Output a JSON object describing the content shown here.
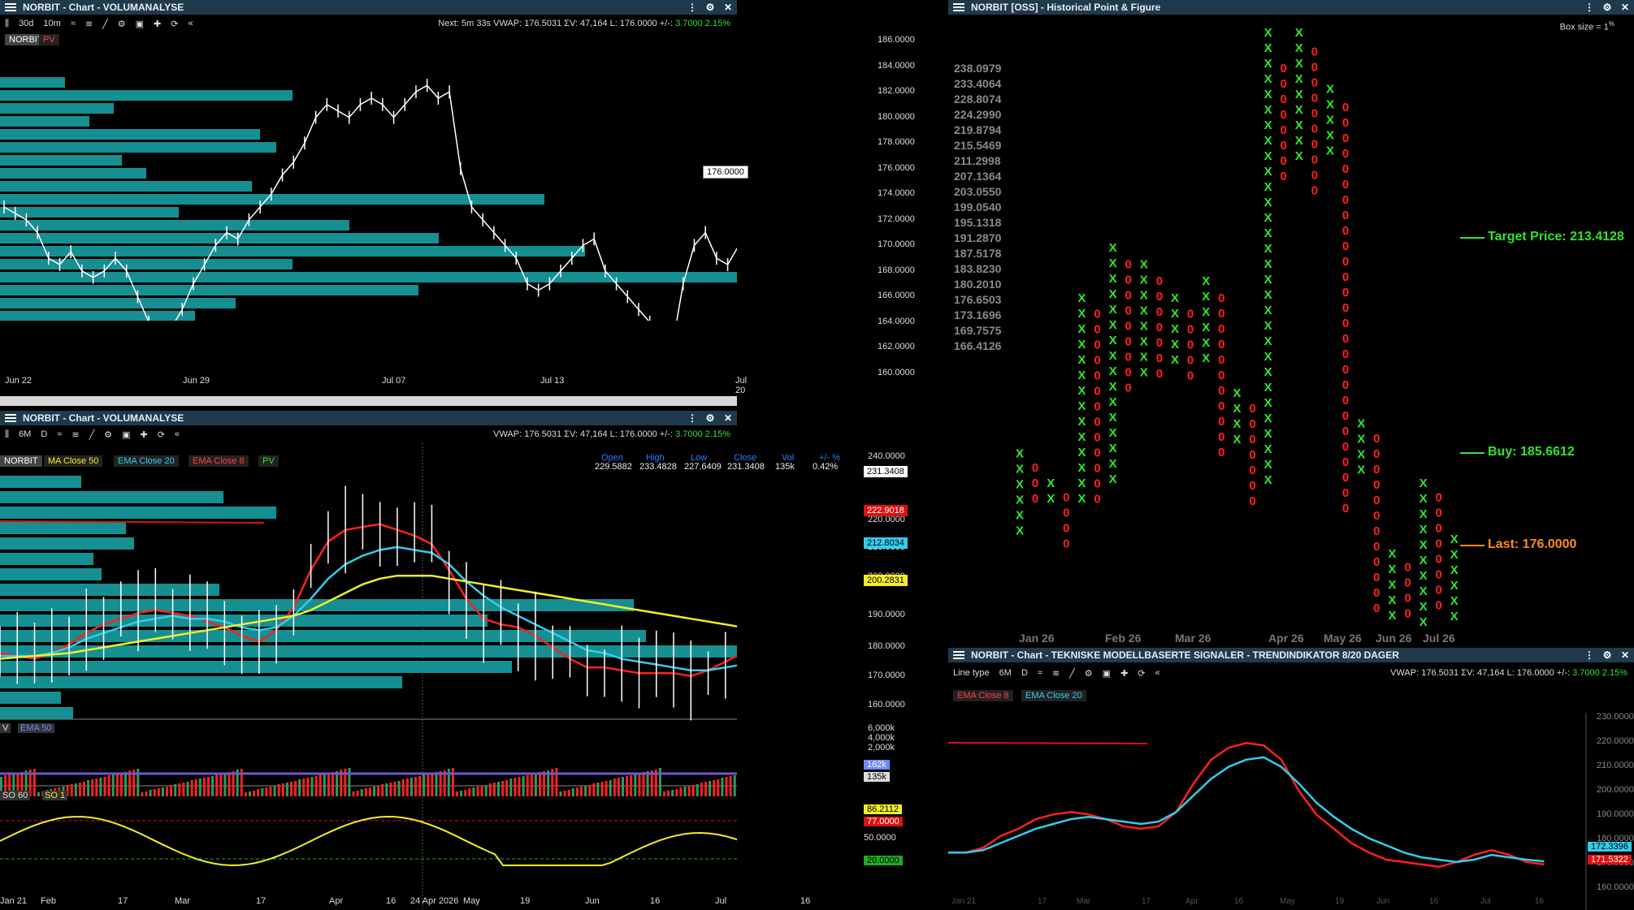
{
  "colors": {
    "bg": "#000000",
    "titlebar": "#1f3a4d",
    "teal": "#168f92",
    "green": "#2ee62e",
    "red": "#ff2020",
    "yellow": "#f2ef25",
    "cyan": "#33ccee",
    "orange": "#ff8c1a"
  },
  "chart1": {
    "title": "NORBIT - Chart - VOLUMANALYSE",
    "toolbar": {
      "period": "30d",
      "interval": "10m",
      "stats_prefix": "Next: 5m 33s  VWAP: 176.5031  ΣV: 47,164  L: 176.0000  +/-: ",
      "stats_change": "3.7000  2.15%"
    },
    "tags": [
      "NORBIT",
      "PV"
    ],
    "last_price": "176.0000",
    "xlabels": [
      "Jun 22",
      "Jun 29",
      "Jul 07",
      "Jul 13",
      "Jul 20"
    ],
    "chart_data": {
      "type": "line",
      "ylim": [
        160,
        186
      ],
      "yticks": [
        "186.0000",
        "184.0000",
        "182.0000",
        "180.0000",
        "178.0000",
        "176.0000",
        "174.0000",
        "172.0000",
        "170.0000",
        "168.0000",
        "166.0000",
        "164.0000",
        "162.0000",
        "160.0000"
      ],
      "series": [
        {
          "values": [
            173,
            172.5,
            172,
            171,
            169,
            168.5,
            169.5,
            168,
            167.5,
            168,
            169,
            168,
            166,
            164,
            163,
            163.5,
            165,
            167,
            168.5,
            170,
            171,
            170.5,
            172,
            173,
            174,
            175.5,
            176.5,
            178,
            180,
            181,
            180.5,
            180,
            181,
            181.5,
            181,
            180,
            181,
            182,
            182.5,
            181.5,
            182,
            176,
            173,
            172,
            171,
            170,
            169,
            167,
            166.5,
            167,
            168,
            169,
            170,
            170.5,
            168,
            167,
            166,
            165,
            164,
            163,
            162,
            167,
            170,
            171,
            169,
            168.5,
            170,
            171,
            170,
            169,
            172,
            172.5,
            172,
            171,
            172.5,
            178,
            176
          ]
        }
      ]
    }
  },
  "chart2": {
    "title": "NORBIT - Chart - VOLUMANALYSE",
    "toolbar": {
      "period": "6M",
      "interval": "D",
      "stats_prefix": "VWAP: 176.5031  ΣV: 47,164  L: 176.0000  +/-: ",
      "stats_change": "3.7000  2.15%"
    },
    "tags": [
      "NORBIT",
      "MA Close 50",
      "EMA Close 20",
      "EMA Close 8",
      "PV"
    ],
    "ohlc_headers": [
      "Open",
      "High",
      "Low",
      "Close",
      "Vol",
      "+/- %"
    ],
    "ohlc_values": [
      "229.5882",
      "233.4828",
      "227.6409",
      "231.3408",
      "135k",
      "0.42%"
    ],
    "price_labels": {
      "last": "231.3408",
      "ema8": "222.9018",
      "ema20": "212.8034",
      "ma50": "200.2831"
    },
    "yticks": [
      "240.0000",
      "220.0000",
      "210.0000",
      "200.0000",
      "190.0000",
      "180.0000",
      "170.0000",
      "160.0000"
    ],
    "volume": {
      "tags": [
        "V",
        "EMA 50"
      ],
      "ticks": [
        "6,000k",
        "4,000k",
        "2,000k"
      ],
      "labels": [
        "162k",
        "135k"
      ]
    },
    "stoch": {
      "tags": [
        "SO 60",
        "SO 1"
      ],
      "labels": [
        "86.2112",
        "77.0000",
        "50.0000",
        "20.0000"
      ]
    },
    "xlabels": [
      "Jan 21",
      "Feb",
      "17",
      "Mar",
      "17",
      "Apr",
      "16",
      "24 Apr 2026",
      "May",
      "19",
      "Jun",
      "16",
      "Jul",
      "16"
    ],
    "chart_data": {
      "type": "line",
      "ylim": [
        160,
        245
      ],
      "series": [
        {
          "name": "EMA Close 8",
          "values": [
            176,
            175,
            174,
            176,
            179,
            183,
            186,
            188,
            190,
            191,
            190,
            189,
            187,
            185,
            182,
            180,
            184,
            192,
            205,
            215,
            219,
            220,
            221,
            219,
            217,
            214,
            205,
            195,
            188,
            186,
            185,
            182,
            178,
            174,
            171,
            171,
            170,
            169,
            169,
            169,
            168,
            170,
            173,
            176,
            178,
            177,
            174,
            172,
            171,
            172
          ]
        },
        {
          "name": "EMA Close 20",
          "values": [
            175,
            175,
            175,
            176,
            178,
            181,
            183,
            185,
            187,
            188,
            189,
            188,
            188,
            187,
            185,
            184,
            185,
            189,
            195,
            202,
            207,
            210,
            212,
            213,
            212,
            211,
            207,
            201,
            196,
            192,
            189,
            186,
            183,
            180,
            177,
            176,
            174,
            173,
            172,
            171,
            170,
            170,
            171,
            172,
            174,
            174,
            173,
            172,
            172,
            172.5
          ]
        },
        {
          "name": "MA Close 50",
          "values": [
            174,
            174.5,
            175,
            175.5,
            176,
            177,
            178,
            179,
            180,
            181,
            182,
            183,
            184,
            185,
            186,
            187,
            188,
            189,
            191,
            194,
            197,
            200,
            202,
            203,
            203,
            203,
            202,
            201,
            200,
            199,
            198,
            197,
            196,
            195,
            194,
            193,
            192,
            191,
            190,
            189,
            188,
            187,
            186,
            185,
            184,
            182,
            180,
            178,
            176,
            174
          ]
        }
      ]
    }
  },
  "pf": {
    "title": "NORBIT [OSS] - Historical Point & Figure",
    "box_size_label": "Box size = 1",
    "box_size_sup": "%",
    "yticks": [
      "238.0979",
      "233.4064",
      "228.8074",
      "224.2990",
      "219.8794",
      "215.5469",
      "211.2998",
      "207.1364",
      "203.0550",
      "199.0540",
      "195.1318",
      "191.2870",
      "187.5178",
      "183.8230",
      "180.2010",
      "176.6503",
      "173.1696",
      "169.7575",
      "166.4126"
    ],
    "xlabels": [
      "Jan 26",
      "Feb 26",
      "Mar 26",
      "Apr 26",
      "May 26",
      "Jun 26",
      "Jul 26"
    ],
    "target_label": "Target Price: 213.4128",
    "buy_label": "Buy: 185.6612",
    "last_label": "Last: 176.0000",
    "chart_data": {
      "type": "scatter",
      "columns": [
        {
          "type": "X",
          "top": 187.5,
          "bottom": 176.7
        },
        {
          "type": "O",
          "top": 185.7,
          "bottom": 180.2
        },
        {
          "type": "X",
          "top": 183.8,
          "bottom": 180.2
        },
        {
          "type": "O",
          "top": 182.0,
          "bottom": 175.0
        },
        {
          "type": "X",
          "top": 207.1,
          "bottom": 180.2
        },
        {
          "type": "O",
          "top": 205.1,
          "bottom": 180.2
        },
        {
          "type": "X",
          "top": 213.4,
          "bottom": 183.8
        },
        {
          "type": "O",
          "top": 211.3,
          "bottom": 195.1
        },
        {
          "type": "X",
          "top": 211.3,
          "bottom": 197.1
        },
        {
          "type": "O",
          "top": 209.2,
          "bottom": 197.1
        },
        {
          "type": "X",
          "top": 207.1,
          "bottom": 199.1
        },
        {
          "type": "O",
          "top": 205.1,
          "bottom": 197.1
        },
        {
          "type": "X",
          "top": 209.2,
          "bottom": 199.1
        },
        {
          "type": "O",
          "top": 207.1,
          "bottom": 187.5
        },
        {
          "type": "X",
          "top": 195.1,
          "bottom": 187.5
        },
        {
          "type": "O",
          "top": 193.2,
          "bottom": 180.2
        },
        {
          "type": "X",
          "top": 240.5,
          "bottom": 183.8
        },
        {
          "type": "O",
          "top": 236.0,
          "bottom": 222.0
        },
        {
          "type": "X",
          "top": 240.5,
          "bottom": 224.3
        },
        {
          "type": "O",
          "top": 238.1,
          "bottom": 219.9
        },
        {
          "type": "X",
          "top": 233.4,
          "bottom": 224.3
        },
        {
          "type": "O",
          "top": 231.1,
          "bottom": 180.2
        },
        {
          "type": "X",
          "top": 191.3,
          "bottom": 183.8
        },
        {
          "type": "O",
          "top": 189.4,
          "bottom": 166.4
        },
        {
          "type": "X",
          "top": 174.9,
          "bottom": 166.4
        },
        {
          "type": "O",
          "top": 173.2,
          "bottom": 166.4
        },
        {
          "type": "X",
          "top": 183.8,
          "bottom": 166.4
        },
        {
          "type": "O",
          "top": 182.0,
          "bottom": 168.1
        },
        {
          "type": "X",
          "top": 176.7,
          "bottom": 166.4
        }
      ]
    }
  },
  "chart3": {
    "title": "NORBIT - Chart - TEKNISKE MODELLBASERTE SIGNALER - TRENDINDIKATOR 8/20 DAGER",
    "toolbar": {
      "linetype": "Line type",
      "period": "6M",
      "interval": "D",
      "stats_prefix": "VWAP: 176.5031  ΣV: 47,164  L: 176.0000  +/-: ",
      "stats_change": "3.7000  2.15%"
    },
    "tags": [
      "EMA Close 8",
      "EMA Close 20"
    ],
    "yticks": [
      "230.0000",
      "220.0000",
      "210.0000",
      "200.0000",
      "190.0000",
      "180.0000",
      "170.0000",
      "160.0000"
    ],
    "price_labels": {
      "ema20": "172.3396",
      "ema8": "171.5322"
    },
    "xlabels": [
      "Jan 21",
      "17",
      "Mar",
      "17",
      "Apr",
      "16",
      "May",
      "19",
      "Jun",
      "16",
      "Jul",
      "16"
    ],
    "chart_data": {
      "type": "line",
      "ylim": [
        158,
        233
      ],
      "series": [
        {
          "name": "EMA Close 8",
          "values": [
            176,
            176,
            178,
            183,
            186,
            190,
            192,
            193,
            192,
            190,
            187,
            186,
            187,
            193,
            205,
            215,
            220,
            222,
            221,
            215,
            202,
            192,
            186,
            180,
            176,
            173,
            172,
            171,
            170,
            172,
            175,
            177,
            175,
            172,
            171
          ]
        },
        {
          "name": "EMA Close 20",
          "values": [
            176,
            176,
            177,
            180,
            183,
            186,
            188,
            190,
            191,
            190,
            189,
            188,
            189,
            193,
            200,
            207,
            212,
            215,
            216,
            212,
            205,
            197,
            191,
            186,
            182,
            179,
            176,
            174,
            173,
            172,
            173,
            175,
            174,
            173,
            172.3
          ]
        }
      ]
    }
  }
}
